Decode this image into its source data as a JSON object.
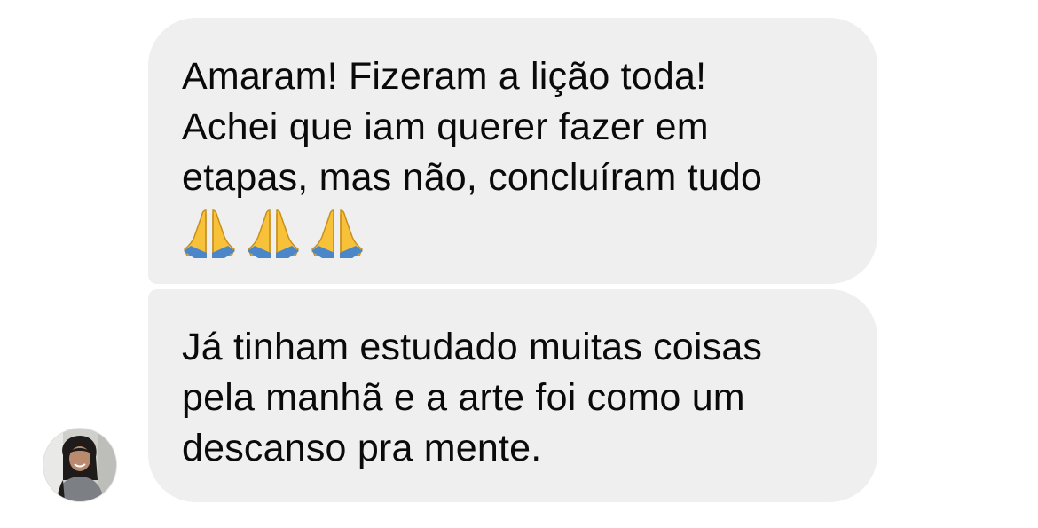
{
  "messages": [
    {
      "lines": [
        "Amaram! Fizeram a lição toda!",
        "Achei que iam querer fazer em",
        "etapas, mas não, concluíram tudo"
      ],
      "emojis": [
        "folded-hands-icon",
        "folded-hands-icon",
        "folded-hands-icon"
      ]
    },
    {
      "lines": [
        "Já tinham estudado muitas coisas",
        "pela manhã e a arte foi como um",
        "descanso pra mente."
      ]
    }
  ],
  "colors": {
    "bubble_background": "#efefef",
    "text": "#0a0a0a",
    "emoji_yellow": "#f7c23a",
    "emoji_sleeve": "#4a86c8"
  },
  "avatar": {
    "icon": "sender-avatar"
  }
}
